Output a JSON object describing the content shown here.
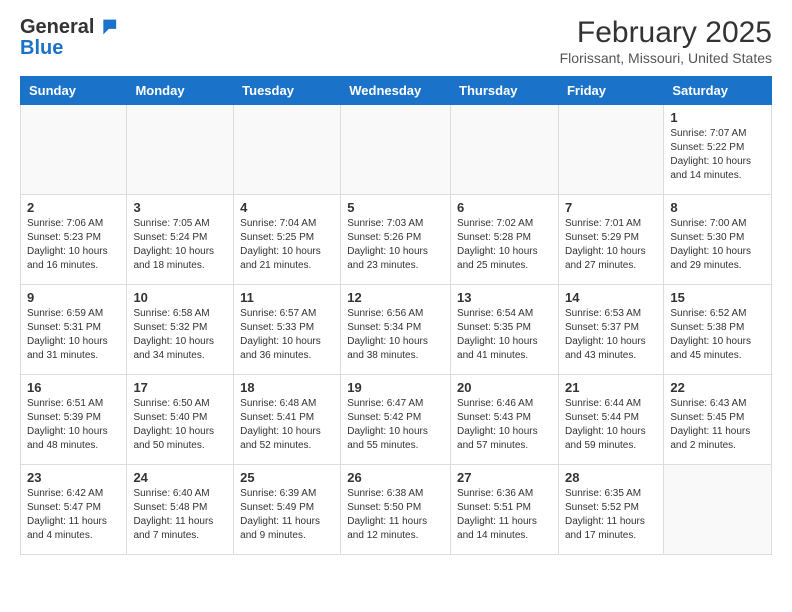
{
  "logo": {
    "general": "General",
    "blue": "Blue"
  },
  "title": "February 2025",
  "subtitle": "Florissant, Missouri, United States",
  "weekdays": [
    "Sunday",
    "Monday",
    "Tuesday",
    "Wednesday",
    "Thursday",
    "Friday",
    "Saturday"
  ],
  "weeks": [
    [
      null,
      null,
      null,
      null,
      null,
      null,
      {
        "day": "1",
        "sunrise": "7:07 AM",
        "sunset": "5:22 PM",
        "daylight": "10 hours and 14 minutes."
      }
    ],
    [
      {
        "day": "2",
        "sunrise": "7:06 AM",
        "sunset": "5:23 PM",
        "daylight": "10 hours and 16 minutes."
      },
      {
        "day": "3",
        "sunrise": "7:05 AM",
        "sunset": "5:24 PM",
        "daylight": "10 hours and 18 minutes."
      },
      {
        "day": "4",
        "sunrise": "7:04 AM",
        "sunset": "5:25 PM",
        "daylight": "10 hours and 21 minutes."
      },
      {
        "day": "5",
        "sunrise": "7:03 AM",
        "sunset": "5:26 PM",
        "daylight": "10 hours and 23 minutes."
      },
      {
        "day": "6",
        "sunrise": "7:02 AM",
        "sunset": "5:28 PM",
        "daylight": "10 hours and 25 minutes."
      },
      {
        "day": "7",
        "sunrise": "7:01 AM",
        "sunset": "5:29 PM",
        "daylight": "10 hours and 27 minutes."
      },
      {
        "day": "8",
        "sunrise": "7:00 AM",
        "sunset": "5:30 PM",
        "daylight": "10 hours and 29 minutes."
      }
    ],
    [
      {
        "day": "9",
        "sunrise": "6:59 AM",
        "sunset": "5:31 PM",
        "daylight": "10 hours and 31 minutes."
      },
      {
        "day": "10",
        "sunrise": "6:58 AM",
        "sunset": "5:32 PM",
        "daylight": "10 hours and 34 minutes."
      },
      {
        "day": "11",
        "sunrise": "6:57 AM",
        "sunset": "5:33 PM",
        "daylight": "10 hours and 36 minutes."
      },
      {
        "day": "12",
        "sunrise": "6:56 AM",
        "sunset": "5:34 PM",
        "daylight": "10 hours and 38 minutes."
      },
      {
        "day": "13",
        "sunrise": "6:54 AM",
        "sunset": "5:35 PM",
        "daylight": "10 hours and 41 minutes."
      },
      {
        "day": "14",
        "sunrise": "6:53 AM",
        "sunset": "5:37 PM",
        "daylight": "10 hours and 43 minutes."
      },
      {
        "day": "15",
        "sunrise": "6:52 AM",
        "sunset": "5:38 PM",
        "daylight": "10 hours and 45 minutes."
      }
    ],
    [
      {
        "day": "16",
        "sunrise": "6:51 AM",
        "sunset": "5:39 PM",
        "daylight": "10 hours and 48 minutes."
      },
      {
        "day": "17",
        "sunrise": "6:50 AM",
        "sunset": "5:40 PM",
        "daylight": "10 hours and 50 minutes."
      },
      {
        "day": "18",
        "sunrise": "6:48 AM",
        "sunset": "5:41 PM",
        "daylight": "10 hours and 52 minutes."
      },
      {
        "day": "19",
        "sunrise": "6:47 AM",
        "sunset": "5:42 PM",
        "daylight": "10 hours and 55 minutes."
      },
      {
        "day": "20",
        "sunrise": "6:46 AM",
        "sunset": "5:43 PM",
        "daylight": "10 hours and 57 minutes."
      },
      {
        "day": "21",
        "sunrise": "6:44 AM",
        "sunset": "5:44 PM",
        "daylight": "10 hours and 59 minutes."
      },
      {
        "day": "22",
        "sunrise": "6:43 AM",
        "sunset": "5:45 PM",
        "daylight": "11 hours and 2 minutes."
      }
    ],
    [
      {
        "day": "23",
        "sunrise": "6:42 AM",
        "sunset": "5:47 PM",
        "daylight": "11 hours and 4 minutes."
      },
      {
        "day": "24",
        "sunrise": "6:40 AM",
        "sunset": "5:48 PM",
        "daylight": "11 hours and 7 minutes."
      },
      {
        "day": "25",
        "sunrise": "6:39 AM",
        "sunset": "5:49 PM",
        "daylight": "11 hours and 9 minutes."
      },
      {
        "day": "26",
        "sunrise": "6:38 AM",
        "sunset": "5:50 PM",
        "daylight": "11 hours and 12 minutes."
      },
      {
        "day": "27",
        "sunrise": "6:36 AM",
        "sunset": "5:51 PM",
        "daylight": "11 hours and 14 minutes."
      },
      {
        "day": "28",
        "sunrise": "6:35 AM",
        "sunset": "5:52 PM",
        "daylight": "11 hours and 17 minutes."
      },
      null
    ]
  ]
}
